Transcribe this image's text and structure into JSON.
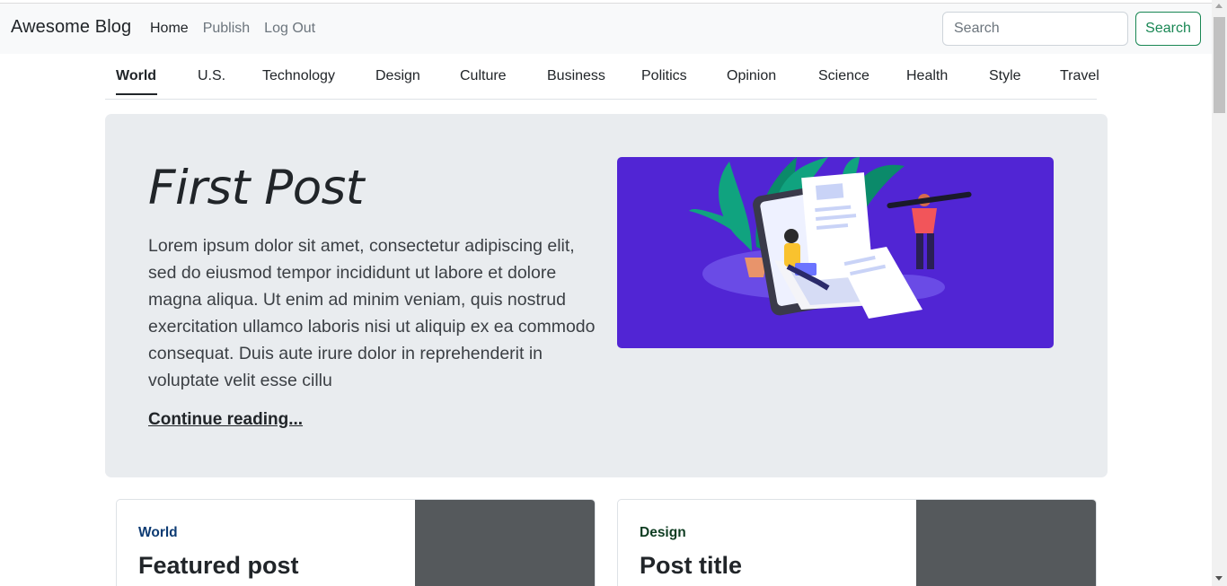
{
  "navbar": {
    "brand": "Awesome Blog",
    "links": [
      {
        "label": "Home",
        "active": true
      },
      {
        "label": "Publish",
        "active": false
      },
      {
        "label": "Log Out",
        "active": false
      }
    ],
    "search_placeholder": "Search",
    "search_button": "Search"
  },
  "categories": [
    {
      "label": "World",
      "active": true
    },
    {
      "label": "U.S."
    },
    {
      "label": "Technology"
    },
    {
      "label": "Design"
    },
    {
      "label": "Culture"
    },
    {
      "label": "Business"
    },
    {
      "label": "Politics"
    },
    {
      "label": "Opinion"
    },
    {
      "label": "Science"
    },
    {
      "label": "Health"
    },
    {
      "label": "Style"
    },
    {
      "label": "Travel"
    }
  ],
  "hero": {
    "title": "First Post",
    "text": "Lorem ipsum dolor sit amet, consectetur adipiscing elit, sed do eiusmod tempor incididunt ut labore et dolore magna aliqua. Ut enim ad minim veniam, quis nostrud exercitation ullamco laboris nisi ut aliquip ex ea commodo consequat. Duis aute irure dolor in reprehenderit in voluptate velit esse cillu",
    "link": "Continue reading..."
  },
  "cards": [
    {
      "category": "World",
      "category_color": "#0d3b73",
      "title": "Featured post"
    },
    {
      "category": "Design",
      "category_color": "#0f3d22",
      "title": "Post title"
    }
  ],
  "colors": {
    "accent_green": "#198754",
    "hero_image_bg": "#5125d4",
    "hero_bg": "#e9ecef"
  }
}
